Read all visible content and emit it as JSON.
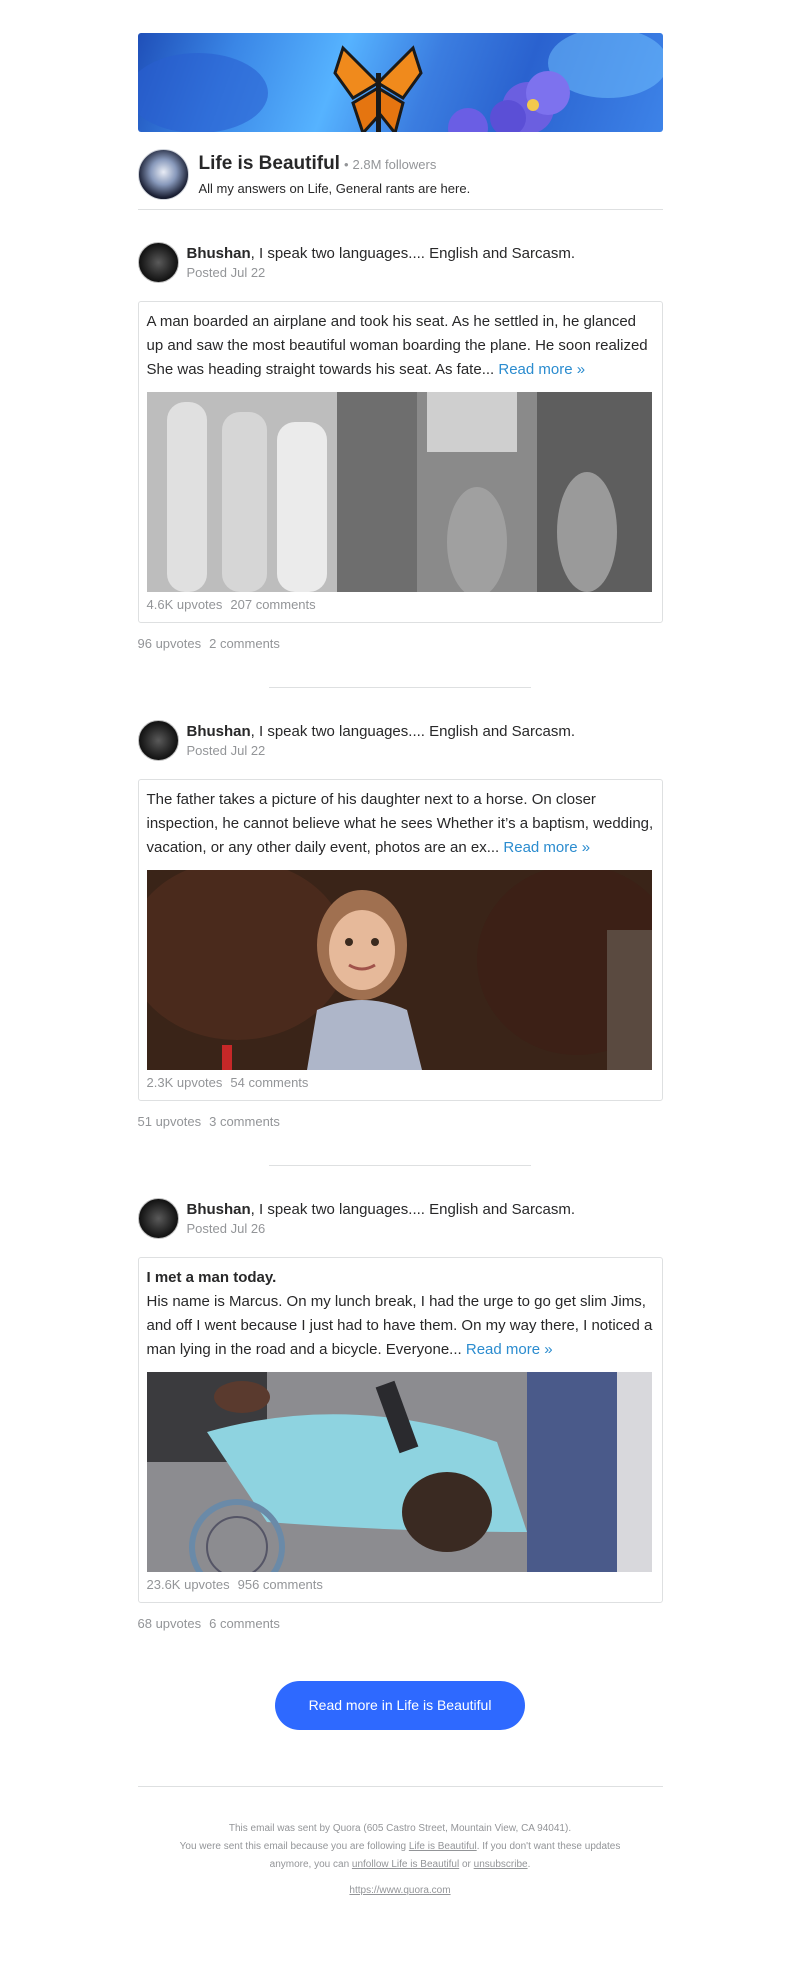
{
  "space": {
    "title": "Life is Beautiful",
    "separator": "•",
    "followers": "2.8M followers",
    "description": "All my answers on Life, General rants are here."
  },
  "posts": [
    {
      "author": "Bhushan",
      "credential": ", I speak two languages.... English and Sarcasm.",
      "posted": "Posted Jul 22",
      "bold_line": "",
      "body": "A man boarded an airplane and took his seat. As he settled in, he glanced up and saw the most beautiful woman boarding the plane. He soon realized She was heading straight towards his seat. As fate...",
      "read_more": "Read more »",
      "card_upvotes": "4.6K upvotes",
      "card_comments": "207 comments",
      "upvotes": "96 upvotes",
      "comments": "2 comments"
    },
    {
      "author": "Bhushan",
      "credential": ", I speak two languages.... English and Sarcasm.",
      "posted": "Posted Jul 22",
      "bold_line": "",
      "body": "The father takes a picture of his daughter next to a horse. On closer inspection, he cannot believe what he sees Whether it’s a baptism, wedding, vacation, or any other daily event, photos are an ex...",
      "read_more": "Read more »",
      "card_upvotes": "2.3K upvotes",
      "card_comments": "54 comments",
      "upvotes": "51 upvotes",
      "comments": "3 comments"
    },
    {
      "author": "Bhushan",
      "credential": ", I speak two languages.... English and Sarcasm.",
      "posted": "Posted Jul 26",
      "bold_line": "I met a man today.",
      "body": "His name is Marcus. On my lunch break, I had the urge to go get slim Jims, and off I went because I just had to have them. On my way there, I noticed a man lying in the road and a bicycle. Everyone...",
      "read_more": "Read more »",
      "card_upvotes": "23.6K upvotes",
      "card_comments": "956 comments",
      "upvotes": "68 upvotes",
      "comments": "6 comments"
    }
  ],
  "cta": {
    "label": "Read more in Life is Beautiful"
  },
  "footer": {
    "line1": "This email was sent by Quora (605 Castro Street, Mountain View, CA 94041).",
    "line2_a": "You were sent this email because you are following ",
    "line2_link": "Life is Beautiful",
    "line2_b": ". If you don't want these updates",
    "line3_a": "anymore, you can ",
    "line3_link1": "unfollow Life is Beautiful",
    "line3_mid": " or ",
    "line3_link2": "unsubscribe",
    "line3_end": ".",
    "url": "https://www.quora.com"
  },
  "colors": {
    "cta": "#2e69ff",
    "link": "#2b8ccf",
    "muted": "#939598",
    "text": "#282829"
  }
}
